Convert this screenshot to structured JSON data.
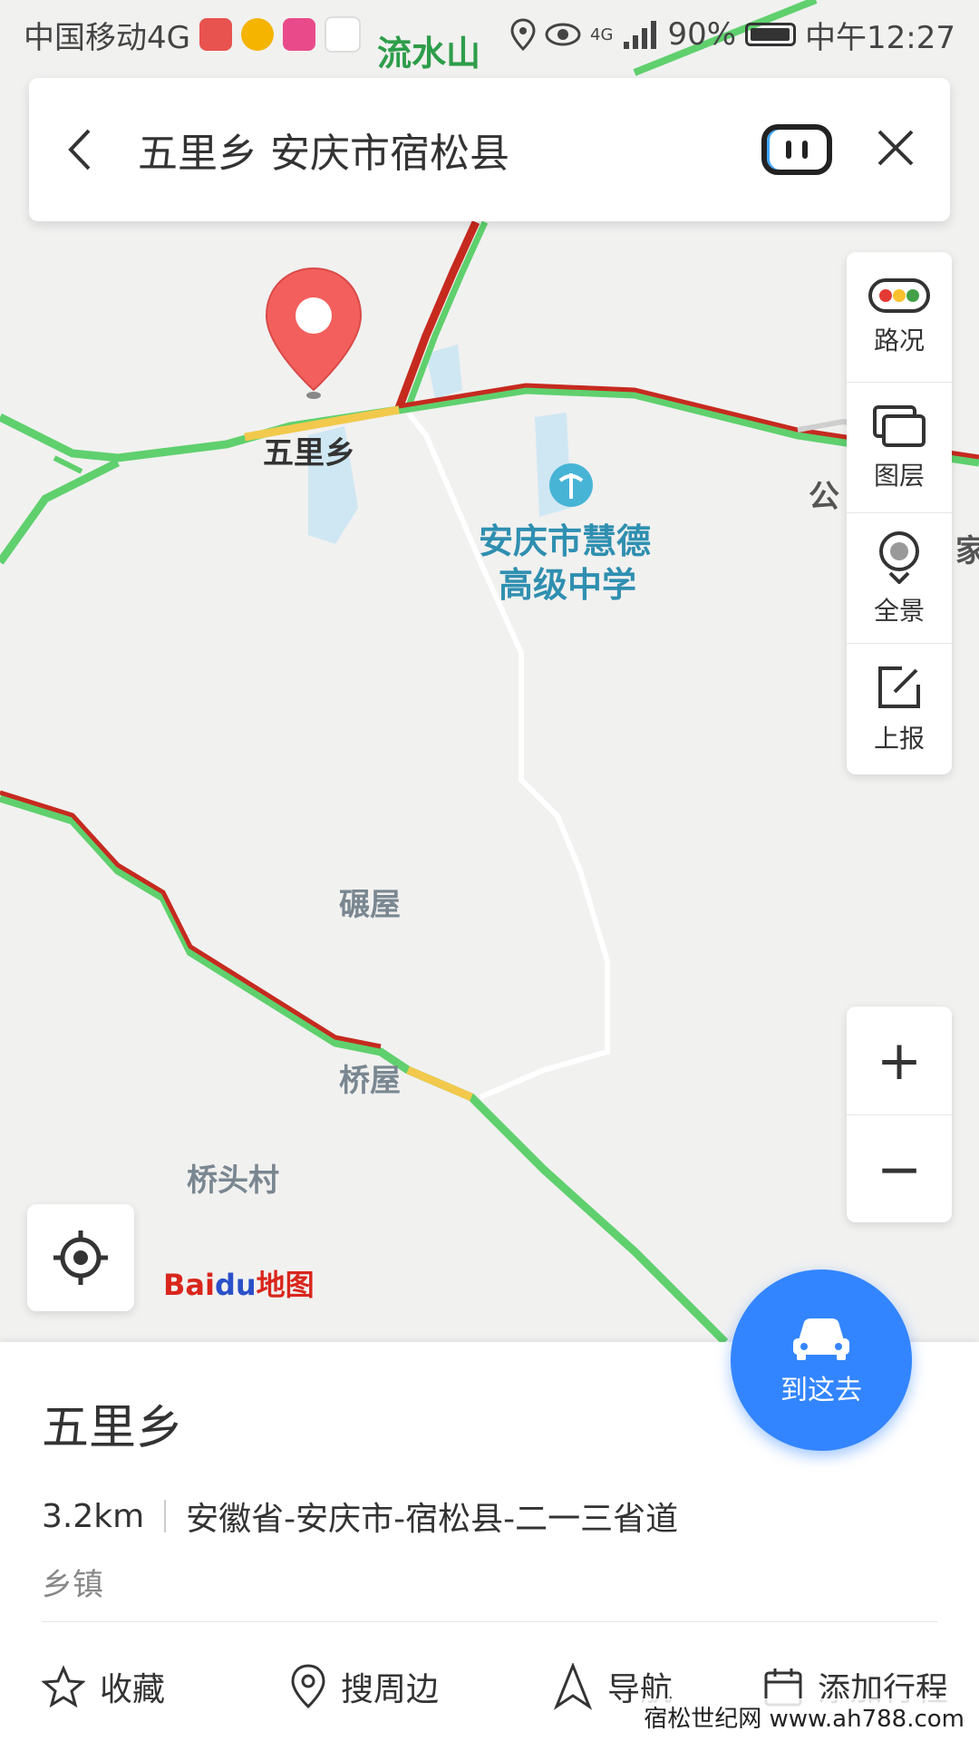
{
  "status_bar": {
    "carrier": "中国移动4G",
    "battery": "90%",
    "time": "中午12:27",
    "network": "4G"
  },
  "search": {
    "query": "五里乡 安庆市宿松县"
  },
  "map": {
    "labels": {
      "top_place": "流水山",
      "pin_place": "五里乡",
      "school": "安庆市慧德",
      "school_line2": "高级中学",
      "village_1": "碾屋",
      "village_2": "桥屋",
      "village_3": "桥头村",
      "edge_1": "公",
      "edge_2": "家"
    },
    "road_colors": {
      "green": "#5fd06d",
      "red": "#c62a1f",
      "yellow": "#f2c94c"
    }
  },
  "tools": [
    {
      "label": "路况",
      "icon": "traffic-light-icon"
    },
    {
      "label": "图层",
      "icon": "layers-icon"
    },
    {
      "label": "全景",
      "icon": "panorama-icon"
    },
    {
      "label": "上报",
      "icon": "report-icon"
    }
  ],
  "zoom": {
    "in": "+",
    "out": "−"
  },
  "logo": {
    "bai": "Bai",
    "du": "du",
    "map": "地图"
  },
  "goto": {
    "label": "到这去"
  },
  "place": {
    "name": "五里乡",
    "distance": "3.2km",
    "address": "安徽省-安庆市-宿松县-二一三省道",
    "category": "乡镇"
  },
  "actions": [
    {
      "label": "收藏",
      "icon": "star-icon"
    },
    {
      "label": "搜周边",
      "icon": "location-pin-icon"
    },
    {
      "label": "导航",
      "icon": "navigation-icon"
    },
    {
      "label": "添加行程",
      "icon": "calendar-icon"
    }
  ],
  "watermark": "宿松世纪网 www.ah788.com",
  "accent_color": "#3385ff"
}
